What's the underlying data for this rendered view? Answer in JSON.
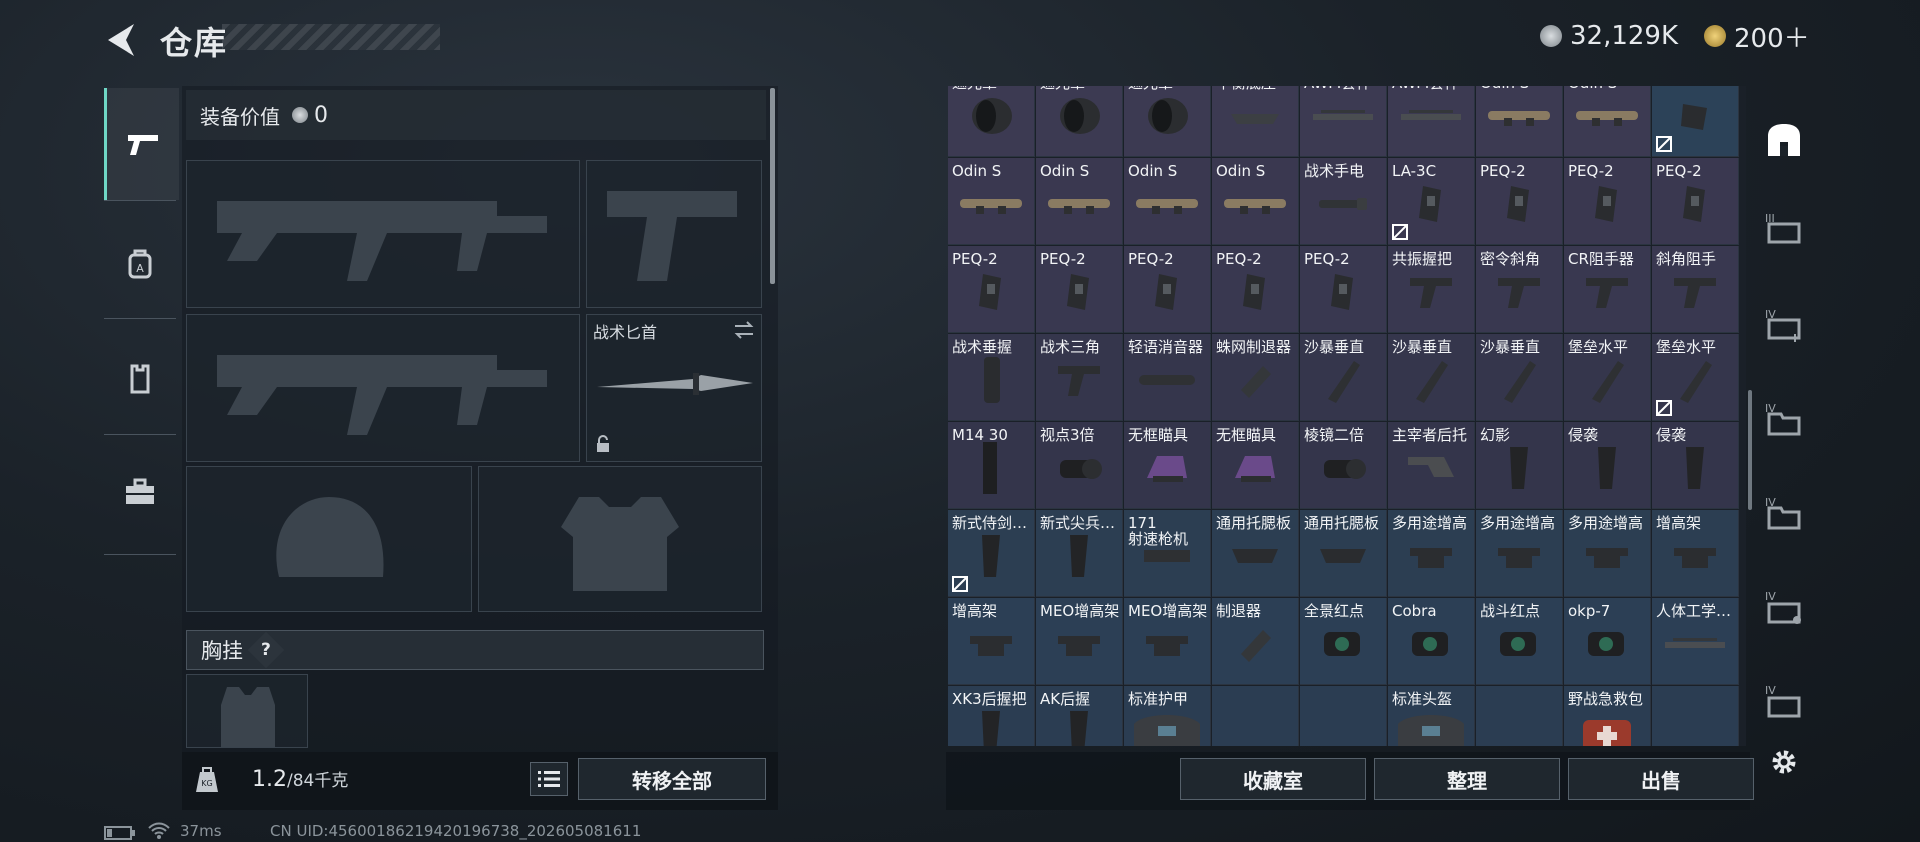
{
  "header": {
    "title": "仓库",
    "currency_silver": "32,129K",
    "currency_gold": "200＋"
  },
  "left_tabs": [
    "weapon-tab",
    "backpack-tab",
    "vest-tab",
    "toolbox-tab"
  ],
  "loadout": {
    "equip_value_label": "装备价值",
    "equip_value": "0",
    "knife_label": "战术匕首",
    "chest_rig_label": "胸挂",
    "help_mark": "?",
    "weight_current": "1.2",
    "weight_total": "/84千克",
    "transfer_all": "转移全部"
  },
  "grid": {
    "rows": [
      [
        {
          "name": "遮光罩",
          "icon": "hood"
        },
        {
          "name": "遮光罩",
          "icon": "hood"
        },
        {
          "name": "遮光罩",
          "icon": "hood"
        },
        {
          "name": "平衡底座",
          "icon": "mount"
        },
        {
          "name": "AWM套件",
          "icon": "rail"
        },
        {
          "name": "AWM套件",
          "icon": "rail"
        },
        {
          "name": "Odin S",
          "icon": "scope"
        },
        {
          "name": "Odin S",
          "icon": "scope"
        },
        {
          "name": "",
          "icon": "block",
          "nocheck": true
        }
      ],
      [
        {
          "name": "Odin S",
          "icon": "scope"
        },
        {
          "name": "Odin S",
          "icon": "scope"
        },
        {
          "name": "Odin S",
          "icon": "scope"
        },
        {
          "name": "Odin S",
          "icon": "scope"
        },
        {
          "name": "战术手电",
          "icon": "flashlight"
        },
        {
          "name": "LA-3C",
          "icon": "laser",
          "nocheck": true
        },
        {
          "name": "PEQ-2",
          "icon": "laser"
        },
        {
          "name": "PEQ-2",
          "icon": "laser"
        },
        {
          "name": "PEQ-2",
          "icon": "laser"
        }
      ],
      [
        {
          "name": "PEQ-2",
          "icon": "laser"
        },
        {
          "name": "PEQ-2",
          "icon": "laser"
        },
        {
          "name": "PEQ-2",
          "icon": "laser"
        },
        {
          "name": "PEQ-2",
          "icon": "laser"
        },
        {
          "name": "PEQ-2",
          "icon": "laser"
        },
        {
          "name": "共振握把",
          "icon": "grip"
        },
        {
          "name": "密令斜角",
          "icon": "grip"
        },
        {
          "name": "CR阻手器",
          "icon": "grip"
        },
        {
          "name": "斜角阻手",
          "icon": "grip"
        }
      ],
      [
        {
          "name": "战术垂握",
          "icon": "vgrip"
        },
        {
          "name": "战术三角",
          "icon": "grip"
        },
        {
          "name": "轻语消音器",
          "icon": "suppressor"
        },
        {
          "name": "蛛网制退器",
          "icon": "brake"
        },
        {
          "name": "沙暴垂直",
          "icon": "barrel"
        },
        {
          "name": "沙暴垂直",
          "icon": "barrel"
        },
        {
          "name": "沙暴垂直",
          "icon": "barrel"
        },
        {
          "name": "堡垒水平",
          "icon": "barrel"
        },
        {
          "name": "堡垒水平",
          "icon": "barrel",
          "nocheck": true
        }
      ],
      [
        {
          "name": "M14 30",
          "icon": "mag"
        },
        {
          "name": "视点3倍",
          "icon": "optic"
        },
        {
          "name": "无框瞄具",
          "icon": "holo"
        },
        {
          "name": "无框瞄具",
          "icon": "holo"
        },
        {
          "name": "棱镜二倍",
          "icon": "optic"
        },
        {
          "name": "主宰者后托",
          "icon": "stock"
        },
        {
          "name": "幻影",
          "icon": "pgrip"
        },
        {
          "name": "侵袭",
          "icon": "pgrip"
        },
        {
          "name": "侵袭",
          "icon": "pgrip"
        }
      ],
      [
        {
          "name": "新式侍剑…",
          "icon": "pgrip",
          "nocheck": true
        },
        {
          "name": "新式尖兵…",
          "icon": "pgrip"
        },
        {
          "name": "171",
          "name2": "射速枪机",
          "icon": "bolt"
        },
        {
          "name": "通用托腮板",
          "icon": "cheek"
        },
        {
          "name": "通用托腮板",
          "icon": "cheek"
        },
        {
          "name": "多用途增高",
          "icon": "riser"
        },
        {
          "name": "多用途增高",
          "icon": "riser"
        },
        {
          "name": "多用途增高",
          "icon": "riser"
        },
        {
          "name": "增高架",
          "icon": "riser"
        }
      ],
      [
        {
          "name": "增高架",
          "icon": "riser"
        },
        {
          "name": "MEO增高架",
          "icon": "riser"
        },
        {
          "name": "MEO增高架",
          "icon": "riser"
        },
        {
          "name": "制退器",
          "icon": "brake"
        },
        {
          "name": "全景红点",
          "icon": "reddot"
        },
        {
          "name": "Cobra",
          "icon": "reddot"
        },
        {
          "name": "战斗红点",
          "icon": "reddot"
        },
        {
          "name": "okp-7",
          "icon": "reddot"
        },
        {
          "name": "人体工学…",
          "icon": "rail"
        }
      ],
      [
        {
          "name": "XK3后握把",
          "icon": "pgrip"
        },
        {
          "name": "AK后握",
          "icon": "pgrip"
        },
        {
          "name": "标准护甲",
          "icon": "bag"
        },
        {
          "name": "",
          "icon": "none"
        },
        {
          "name": "",
          "icon": "none"
        },
        {
          "name": "标准头盔",
          "icon": "bag"
        },
        {
          "name": "",
          "icon": "none"
        },
        {
          "name": "野战急救包",
          "icon": "medkit"
        },
        {
          "name": "",
          "icon": "none"
        }
      ]
    ],
    "row_colors": [
      "#3c3a52",
      "#3a3850",
      "#393850",
      "#35364c",
      "#34354b",
      "#2c3e52",
      "#2c3f55",
      "#2b3d52"
    ]
  },
  "bottom_buttons": [
    "收藏室",
    "整理",
    "出售"
  ],
  "status": {
    "ping": "37ms",
    "uid": "CN UID:4560018621942019673​8_202605081611"
  }
}
